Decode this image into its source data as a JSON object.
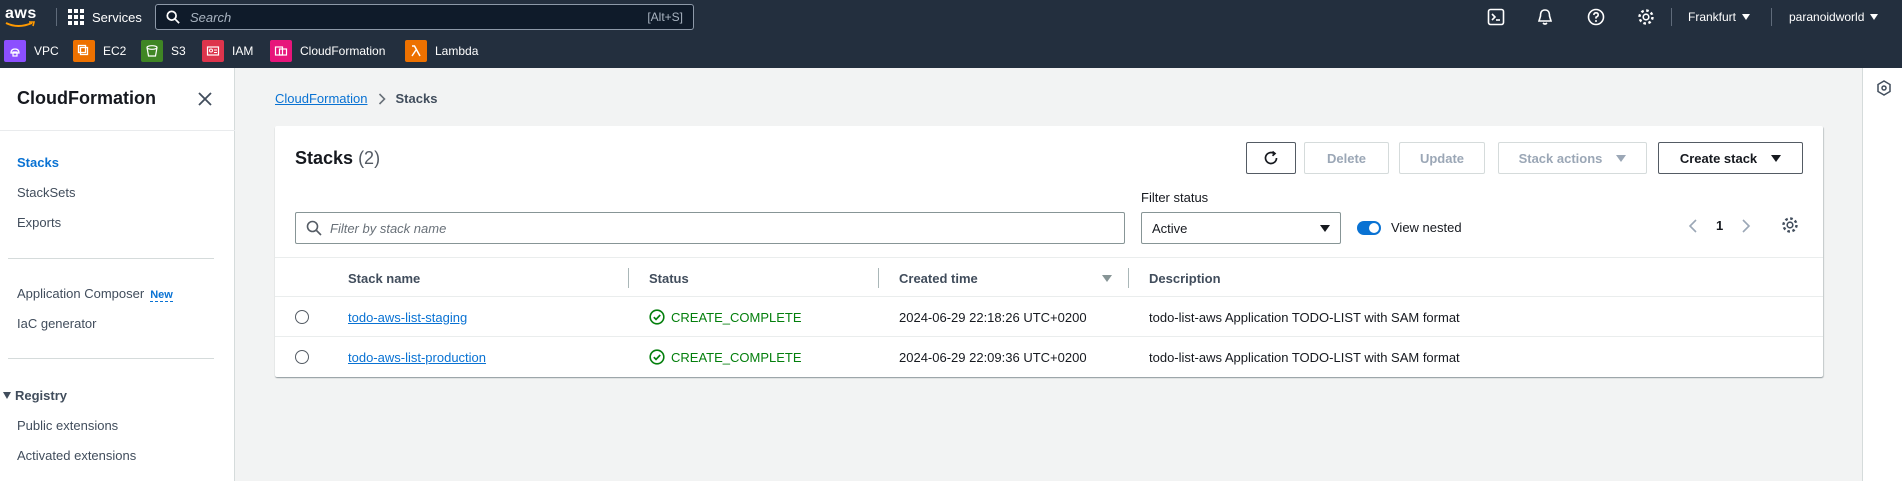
{
  "topnav": {
    "logo": "aws",
    "services_label": "Services",
    "search_placeholder": "Search",
    "search_shortcut": "[Alt+S]",
    "region": "Frankfurt",
    "account": "paranoidworld"
  },
  "favorites": [
    {
      "label": "VPC",
      "color": "#8c4fff"
    },
    {
      "label": "EC2",
      "color": "#ed7100"
    },
    {
      "label": "S3",
      "color": "#3f8624"
    },
    {
      "label": "IAM",
      "color": "#dd344c"
    },
    {
      "label": "CloudFormation",
      "color": "#e7157b"
    },
    {
      "label": "Lambda",
      "color": "#ed7100"
    }
  ],
  "sidebar": {
    "title": "CloudFormation",
    "items": [
      {
        "label": "Stacks"
      },
      {
        "label": "StackSets"
      },
      {
        "label": "Exports"
      },
      {
        "label": "Application Composer",
        "badge": "New"
      },
      {
        "label": "IaC generator"
      },
      {
        "label": "Public extensions"
      },
      {
        "label": "Activated extensions"
      }
    ],
    "registry_label": "Registry"
  },
  "breadcrumb": {
    "root": "CloudFormation",
    "current": "Stacks"
  },
  "panel": {
    "title": "Stacks",
    "count": "(2)",
    "buttons": {
      "delete": "Delete",
      "update": "Update",
      "stack_actions": "Stack actions",
      "create_stack": "Create stack"
    },
    "filter_placeholder": "Filter by stack name",
    "filter_status_label": "Filter status",
    "filter_status_value": "Active",
    "view_nested_label": "View nested",
    "page_number": "1",
    "columns": [
      "Stack name",
      "Status",
      "Created time",
      "Description"
    ],
    "rows": [
      {
        "name": "todo-aws-list-staging",
        "status": "CREATE_COMPLETE",
        "created": "2024-06-29 22:18:26 UTC+0200",
        "description": "todo-list-aws Application TODO-LIST with SAM format"
      },
      {
        "name": "todo-aws-list-production",
        "status": "CREATE_COMPLETE",
        "created": "2024-06-29 22:09:36 UTC+0200",
        "description": "todo-list-aws Application TODO-LIST with SAM format"
      }
    ]
  },
  "colors": {
    "nav_bg": "#232f3e",
    "link": "#0972d3",
    "success": "#037f0c"
  }
}
